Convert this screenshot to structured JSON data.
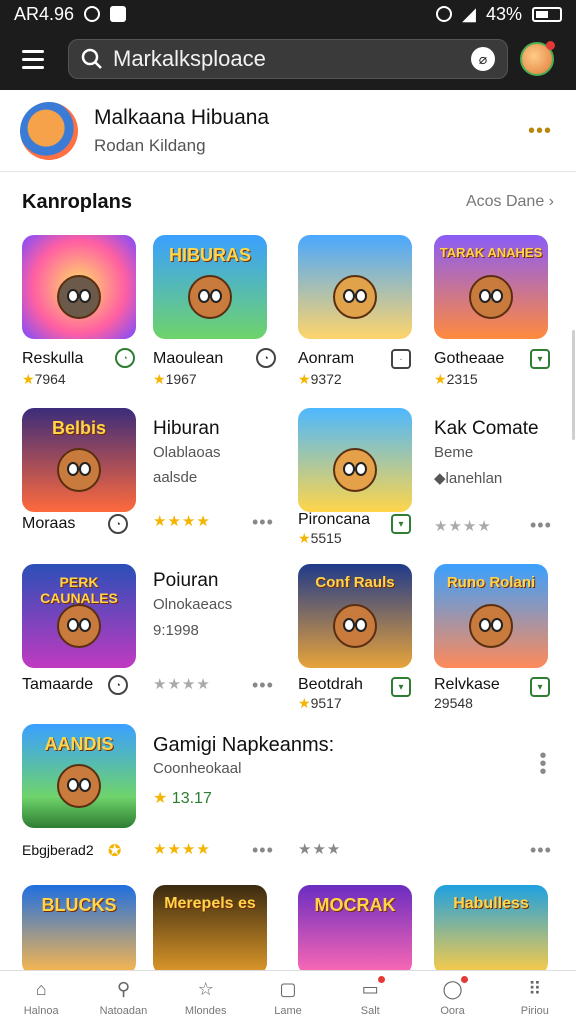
{
  "status": {
    "time": "AR4.96",
    "battery": "43%"
  },
  "search": {
    "value": "Markalksploace"
  },
  "profile": {
    "title": "Malkaana Hibuana",
    "subtitle": "Rodan Kildang",
    "more": "•••"
  },
  "section": {
    "title": "Kanroplans",
    "link": "Acos Dane"
  },
  "row1": [
    {
      "tile_label": "",
      "name": "Reskulla",
      "rating": "7964"
    },
    {
      "tile_label": "HIBURAS",
      "name": "Maoulean",
      "rating": "1967"
    },
    {
      "tile_label": "",
      "name": "Aonram",
      "rating": "9372"
    },
    {
      "tile_label": "TARAK ANAHES",
      "name": "Gotheaae",
      "rating": "2315"
    }
  ],
  "row2": {
    "tile1_label": "Belbis",
    "tile1_name": "Moraas",
    "info_title": "Hiburan",
    "info_sub1": "Olablaoas",
    "info_sub2": "aalsde",
    "stars_gold": "★★★★",
    "tile3_name": "Pironcana",
    "tile3_rating": "5515",
    "right_title": "Kak Comate",
    "right_sub1": "Beme",
    "right_sub2": "lanehlan",
    "stars_gray": "★★★★"
  },
  "row3": {
    "tile1_label": "PERK CAUNALES",
    "tile1_name": "Tamaarde",
    "info_title": "Poiuran",
    "info_sub1": "Olnokaeacs",
    "info_sub2": "9:1998",
    "stars_gray": "★★★★",
    "tile3_label": "Conf Rauls",
    "tile3_name": "Beotdrah",
    "tile3_rating": "9517",
    "tile4_label": "Runo Rolani",
    "tile4_name": "Relvkase",
    "tile4_rating": "29548"
  },
  "row4": {
    "tile_label": "AANDIS",
    "name": "Ebgjberad2",
    "info_title": "Gamigi Napkeanms:",
    "info_sub": "Coonheokaal",
    "info_rating": "13.17",
    "stars_gold": "★★★★",
    "stars_mixed": "★★★"
  },
  "row5": [
    {
      "tile_label": "BLUCKS"
    },
    {
      "tile_label": "Merepels es"
    },
    {
      "tile_label": "MOCRAK"
    },
    {
      "tile_label": "Habulless"
    }
  ],
  "nav": [
    {
      "label": "Halnoa",
      "icon": "home-icon"
    },
    {
      "label": "Natoadan",
      "icon": "search-icon"
    },
    {
      "label": "Mlondes",
      "icon": "star-icon"
    },
    {
      "label": "Lame",
      "icon": "square-icon"
    },
    {
      "label": "Salt",
      "icon": "inbox-icon"
    },
    {
      "label": "Oora",
      "icon": "circle-icon"
    },
    {
      "label": "Piriou",
      "icon": "grid-icon"
    }
  ]
}
